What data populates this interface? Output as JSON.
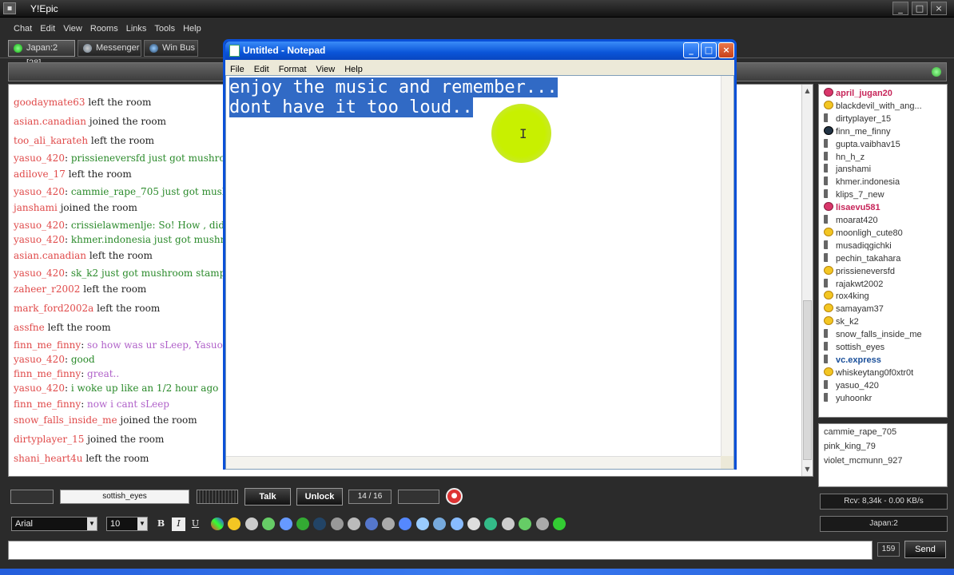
{
  "app": {
    "title": "Y!Epic",
    "title_controls": [
      "_",
      "□",
      "×"
    ]
  },
  "menu": [
    "Chat",
    "Edit",
    "View",
    "Rooms",
    "Links",
    "Tools",
    "Help"
  ],
  "tabs": [
    {
      "label": "Japan:2 [28]",
      "icon": "green-status-icon"
    },
    {
      "label": "Messenger",
      "icon": "messenger-icon"
    },
    {
      "label": "Win Bus",
      "icon": "win-bus-icon"
    }
  ],
  "chat": {
    "lines": [
      {
        "nick": "goodaymate63",
        "text": "left the room",
        "kind": "event"
      },
      {
        "nick": "asian.canadian",
        "text": "joined the room",
        "kind": "event"
      },
      {
        "nick": "too_ali_karateh",
        "text": "left the room",
        "kind": "event"
      },
      {
        "nick": "yasuo_420",
        "text": "prissieneversfd just got mushroom",
        "kind": "green"
      },
      {
        "nick": "adilove_17",
        "text": "left the room",
        "kind": "event"
      },
      {
        "nick": "yasuo_420",
        "text": "cammie_rape_705 just got mush",
        "kind": "green"
      },
      {
        "nick": "janshami",
        "text": "joined the room",
        "kind": "event"
      },
      {
        "nick": "yasuo_420",
        "text": "crissielawmenlje: So! How , did y",
        "kind": "green"
      },
      {
        "nick": "yasuo_420",
        "text": "khmer.indonesia just got mushro",
        "kind": "green"
      },
      {
        "nick": "asian.canadian",
        "text": "left the room",
        "kind": "event"
      },
      {
        "nick": "yasuo_420",
        "text": "sk_k2 just got mushroom stampe",
        "kind": "green"
      },
      {
        "nick": "zaheer_r2002",
        "text": "left the room",
        "kind": "event"
      },
      {
        "nick": "mark_ford2002a",
        "text": "left the room",
        "kind": "event"
      },
      {
        "nick": "assfne",
        "text": "left the room",
        "kind": "event"
      },
      {
        "nick": "finn_me_finny",
        "text": "so how was ur sLeep, Yasuo",
        "kind": "purple"
      },
      {
        "nick": "yasuo_420",
        "text": "good",
        "kind": "green"
      },
      {
        "nick": "finn_me_finny",
        "text": "great..",
        "kind": "purple"
      },
      {
        "nick": "yasuo_420",
        "text": "i woke up like an 1/2 hour ago",
        "kind": "green"
      },
      {
        "nick": "finn_me_finny",
        "text": "now i cant sLeep",
        "kind": "purple"
      },
      {
        "nick": "snow_falls_inside_me",
        "text": "joined the room",
        "kind": "event"
      },
      {
        "nick": "dirtyplayer_15",
        "text": "joined the room",
        "kind": "event"
      },
      {
        "nick": "shani_heart4u",
        "text": "left the room",
        "kind": "event"
      }
    ]
  },
  "users": [
    {
      "name": "april_jugan20",
      "style": "pink",
      "icon": "red"
    },
    {
      "name": "blackdevil_with_ang...",
      "style": "",
      "icon": "smile"
    },
    {
      "name": "dirtyplayer_15",
      "style": "",
      "icon": "spk"
    },
    {
      "name": "finn_me_finny",
      "style": "",
      "icon": "dark"
    },
    {
      "name": "gupta.vaibhav15",
      "style": "",
      "icon": "spk"
    },
    {
      "name": "hn_h_z",
      "style": "",
      "icon": "spk"
    },
    {
      "name": "janshami",
      "style": "",
      "icon": "spk"
    },
    {
      "name": "khmer.indonesia",
      "style": "",
      "icon": "spk"
    },
    {
      "name": "klips_7_new",
      "style": "",
      "icon": "spk"
    },
    {
      "name": "lisaevu581",
      "style": "pink",
      "icon": "red"
    },
    {
      "name": "moarat420",
      "style": "",
      "icon": "spk"
    },
    {
      "name": "moonligh_cute80",
      "style": "",
      "icon": "smile"
    },
    {
      "name": "musadiqgichki",
      "style": "",
      "icon": "spk"
    },
    {
      "name": "pechin_takahara",
      "style": "",
      "icon": "spk"
    },
    {
      "name": "prissieneversfd",
      "style": "",
      "icon": "smile"
    },
    {
      "name": "rajakwt2002",
      "style": "",
      "icon": "spk"
    },
    {
      "name": "rox4king",
      "style": "",
      "icon": "smile"
    },
    {
      "name": "samayam37",
      "style": "",
      "icon": "smile"
    },
    {
      "name": "sk_k2",
      "style": "",
      "icon": "smile"
    },
    {
      "name": "snow_falls_inside_me",
      "style": "",
      "icon": "spk"
    },
    {
      "name": "sottish_eyes",
      "style": "",
      "icon": "spk"
    },
    {
      "name": "vc.express",
      "style": "bold",
      "icon": "spk"
    },
    {
      "name": "whiskeytang0f0xtr0t",
      "style": "",
      "icon": "smile"
    },
    {
      "name": "yasuo_420",
      "style": "",
      "icon": "spk"
    },
    {
      "name": "yuhoonkr",
      "style": "",
      "icon": "spk"
    }
  ],
  "typing_users": [
    "cammie_rape_705",
    "pink_king_79",
    "violet_mcmunn_927"
  ],
  "status": {
    "rcv": "Rcv: 8,34k - 0.00 KB/s",
    "room": "Japan:2"
  },
  "controls": {
    "selected_user": "sottish_eyes",
    "talk_label": "Talk",
    "unlock_label": "Unlock",
    "page": "14 / 16"
  },
  "format": {
    "font": "Arial",
    "size": "10",
    "bold": "B",
    "italic": "I",
    "underline": "U"
  },
  "input": {
    "value": "",
    "char_count": "159",
    "send_label": "Send"
  },
  "notepad": {
    "title": "Untitled - Notepad",
    "menu": [
      "File",
      "Edit",
      "Format",
      "View",
      "Help"
    ],
    "line1": "enjoy the music and remember...",
    "line2": "dont have it too loud..",
    "controls": [
      "_",
      "□",
      "×"
    ]
  },
  "colors": {
    "selection": "#316ac5",
    "xp_title": "#0a55d8",
    "cursor_highlight": "#c8f000",
    "nick": "#e04a4a",
    "message": "#2a8a2a"
  }
}
